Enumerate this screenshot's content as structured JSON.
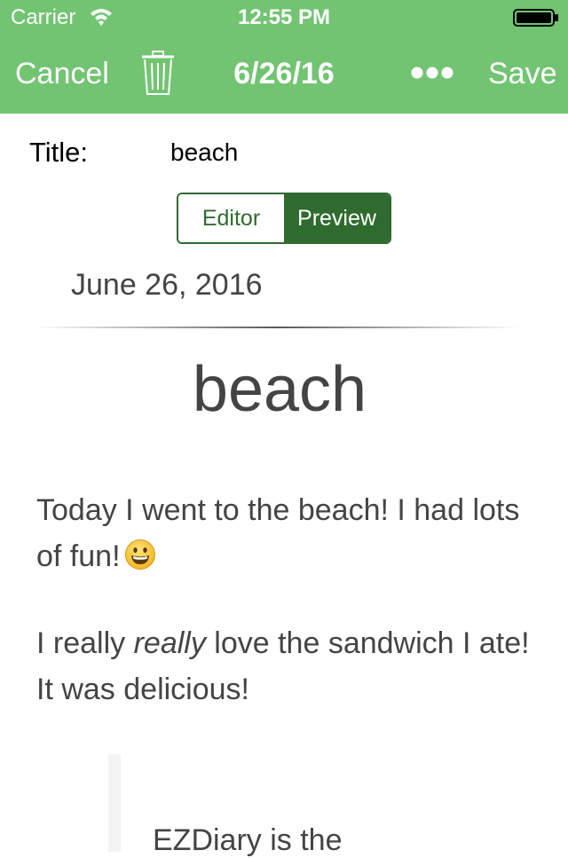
{
  "status_bar": {
    "carrier": "Carrier",
    "time": "12:55 PM",
    "wifi_icon": "wifi-icon",
    "battery_icon": "battery-full-icon"
  },
  "nav": {
    "cancel_label": "Cancel",
    "delete_icon": "trash-icon",
    "title": "6/26/16",
    "more_icon": "ellipsis-icon",
    "save_label": "Save"
  },
  "form": {
    "title_label": "Title:",
    "title_value": "beach"
  },
  "mode_toggle": {
    "options": [
      "Editor",
      "Preview"
    ],
    "selected": "Preview"
  },
  "preview": {
    "date": "June 26, 2016",
    "title": "beach",
    "paragraph1": "Today I went to the beach! I had lots of fun!",
    "paragraph1_emoji": "grinning-face-icon",
    "paragraph2_before": "I really ",
    "paragraph2_emphasis": "really",
    "paragraph2_after": " love the sandwich I ate! It was delicious!",
    "quote_text": "EZDiary is the"
  },
  "colors": {
    "header_green": "#72c472",
    "segment_dark_green": "#2f6b2f",
    "body_text": "#444444"
  }
}
